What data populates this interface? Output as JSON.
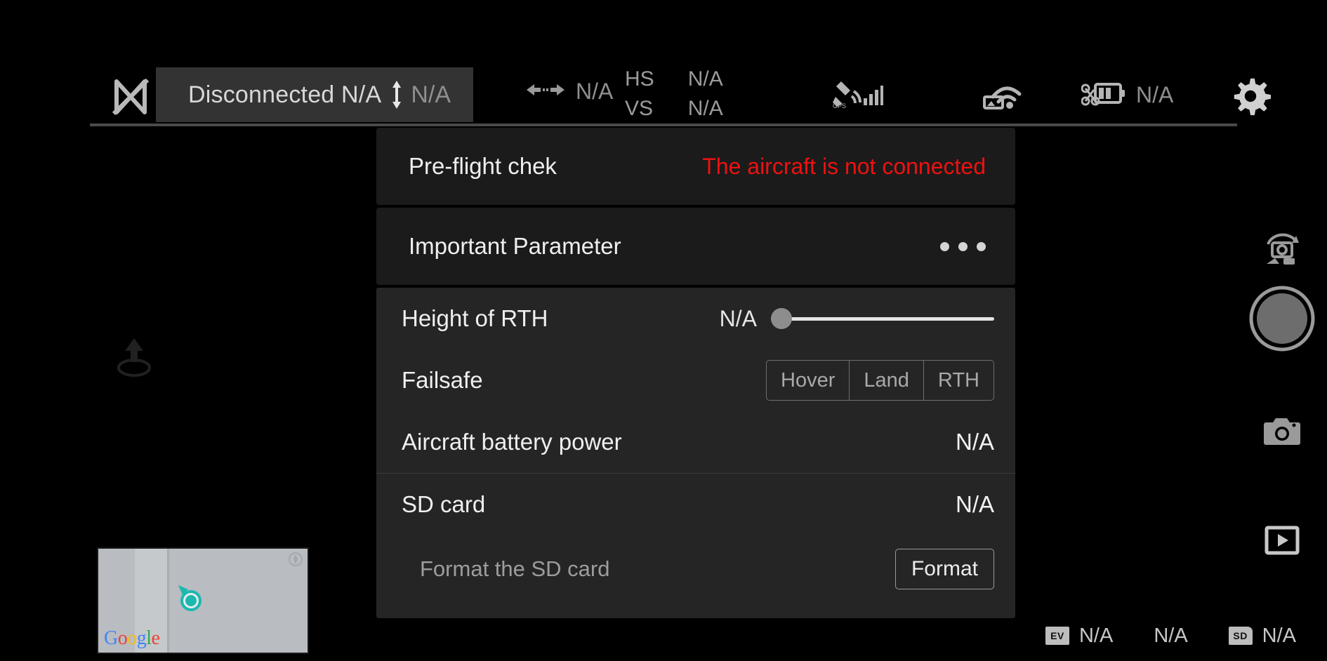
{
  "topbar": {
    "home_icon": "signal-off-icon",
    "connection_status": "Disconnected N/A",
    "altitude_icon": "altitude-arrow-icon",
    "altitude_value": "N/A",
    "distance_icon": "horizontal-distance-icon",
    "distance_value": "N/A",
    "hs_label": "HS",
    "hs_value": "N/A",
    "vs_label": "VS",
    "vs_value": "N/A",
    "gps_icon": "gps-satellite-signal-icon",
    "video_link_icon": "video-downlink-signal-icon",
    "battery_icon": "aircraft-battery-icon",
    "battery_value": "N/A",
    "settings_icon": "gear-icon"
  },
  "panel": {
    "preflight": {
      "label": "Pre-flight chek",
      "status": "The aircraft is not connected",
      "status_color": "#ee1111"
    },
    "important_parameter": {
      "label": "Important Parameter",
      "more_icon": "three-dots-icon"
    },
    "height_of_rth": {
      "label": "Height of RTH",
      "value": "N/A",
      "slider_percent": 0
    },
    "failsafe": {
      "label": "Failsafe",
      "options": [
        "Hover",
        "Land",
        "RTH"
      ],
      "selected": ""
    },
    "aircraft_battery_power": {
      "label": "Aircraft battery power",
      "value": "N/A"
    },
    "sd_card": {
      "label": "SD card",
      "value": "N/A",
      "format_label": "Format the SD card",
      "format_button": "Format"
    }
  },
  "left_controls": {
    "takeoff_icon": "takeoff-icon"
  },
  "map": {
    "provider_logo": "Google",
    "logo_letters": [
      "G",
      "o",
      "o",
      "g",
      "l",
      "e"
    ],
    "marker_color": "#1cb8b0"
  },
  "right_rail": {
    "mode_toggle_icon": "camera-video-mode-toggle-icon",
    "shutter_icon": "shutter-button",
    "photo_icon": "camera-icon",
    "playback_icon": "playback-icon"
  },
  "bottombar": {
    "ev_badge": "EV",
    "ev_value": "N/A",
    "shutter_value": "N/A",
    "sd_badge": "SD",
    "sd_value": "N/A"
  }
}
